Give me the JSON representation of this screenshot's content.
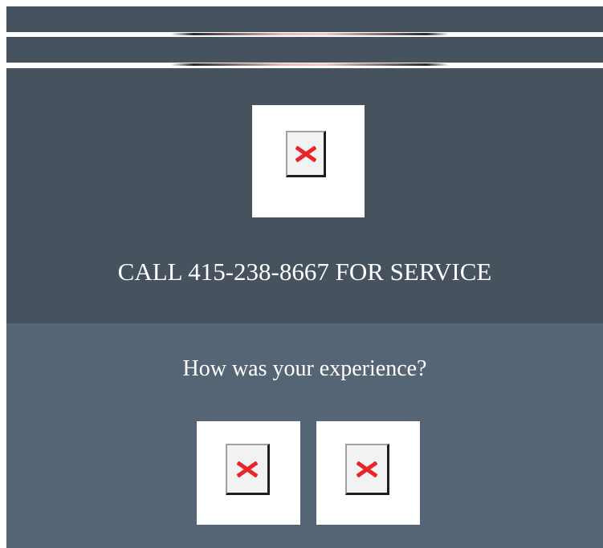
{
  "header": {
    "bars": [
      "",
      ""
    ]
  },
  "hero": {
    "logo": {
      "icon": "broken-image-icon"
    },
    "service_text": "CALL 415-238-8667 FOR SERVICE"
  },
  "feedback": {
    "question": "How was your experience?",
    "options": [
      {
        "name": "thumbs-up",
        "icon": "broken-image-icon"
      },
      {
        "name": "thumbs-down",
        "icon": "broken-image-icon"
      }
    ]
  },
  "colors": {
    "hero_bg": "#46525e",
    "feedback_bg": "#566575",
    "text": "#ffffff",
    "broken_icon_x": "#e8262a"
  }
}
